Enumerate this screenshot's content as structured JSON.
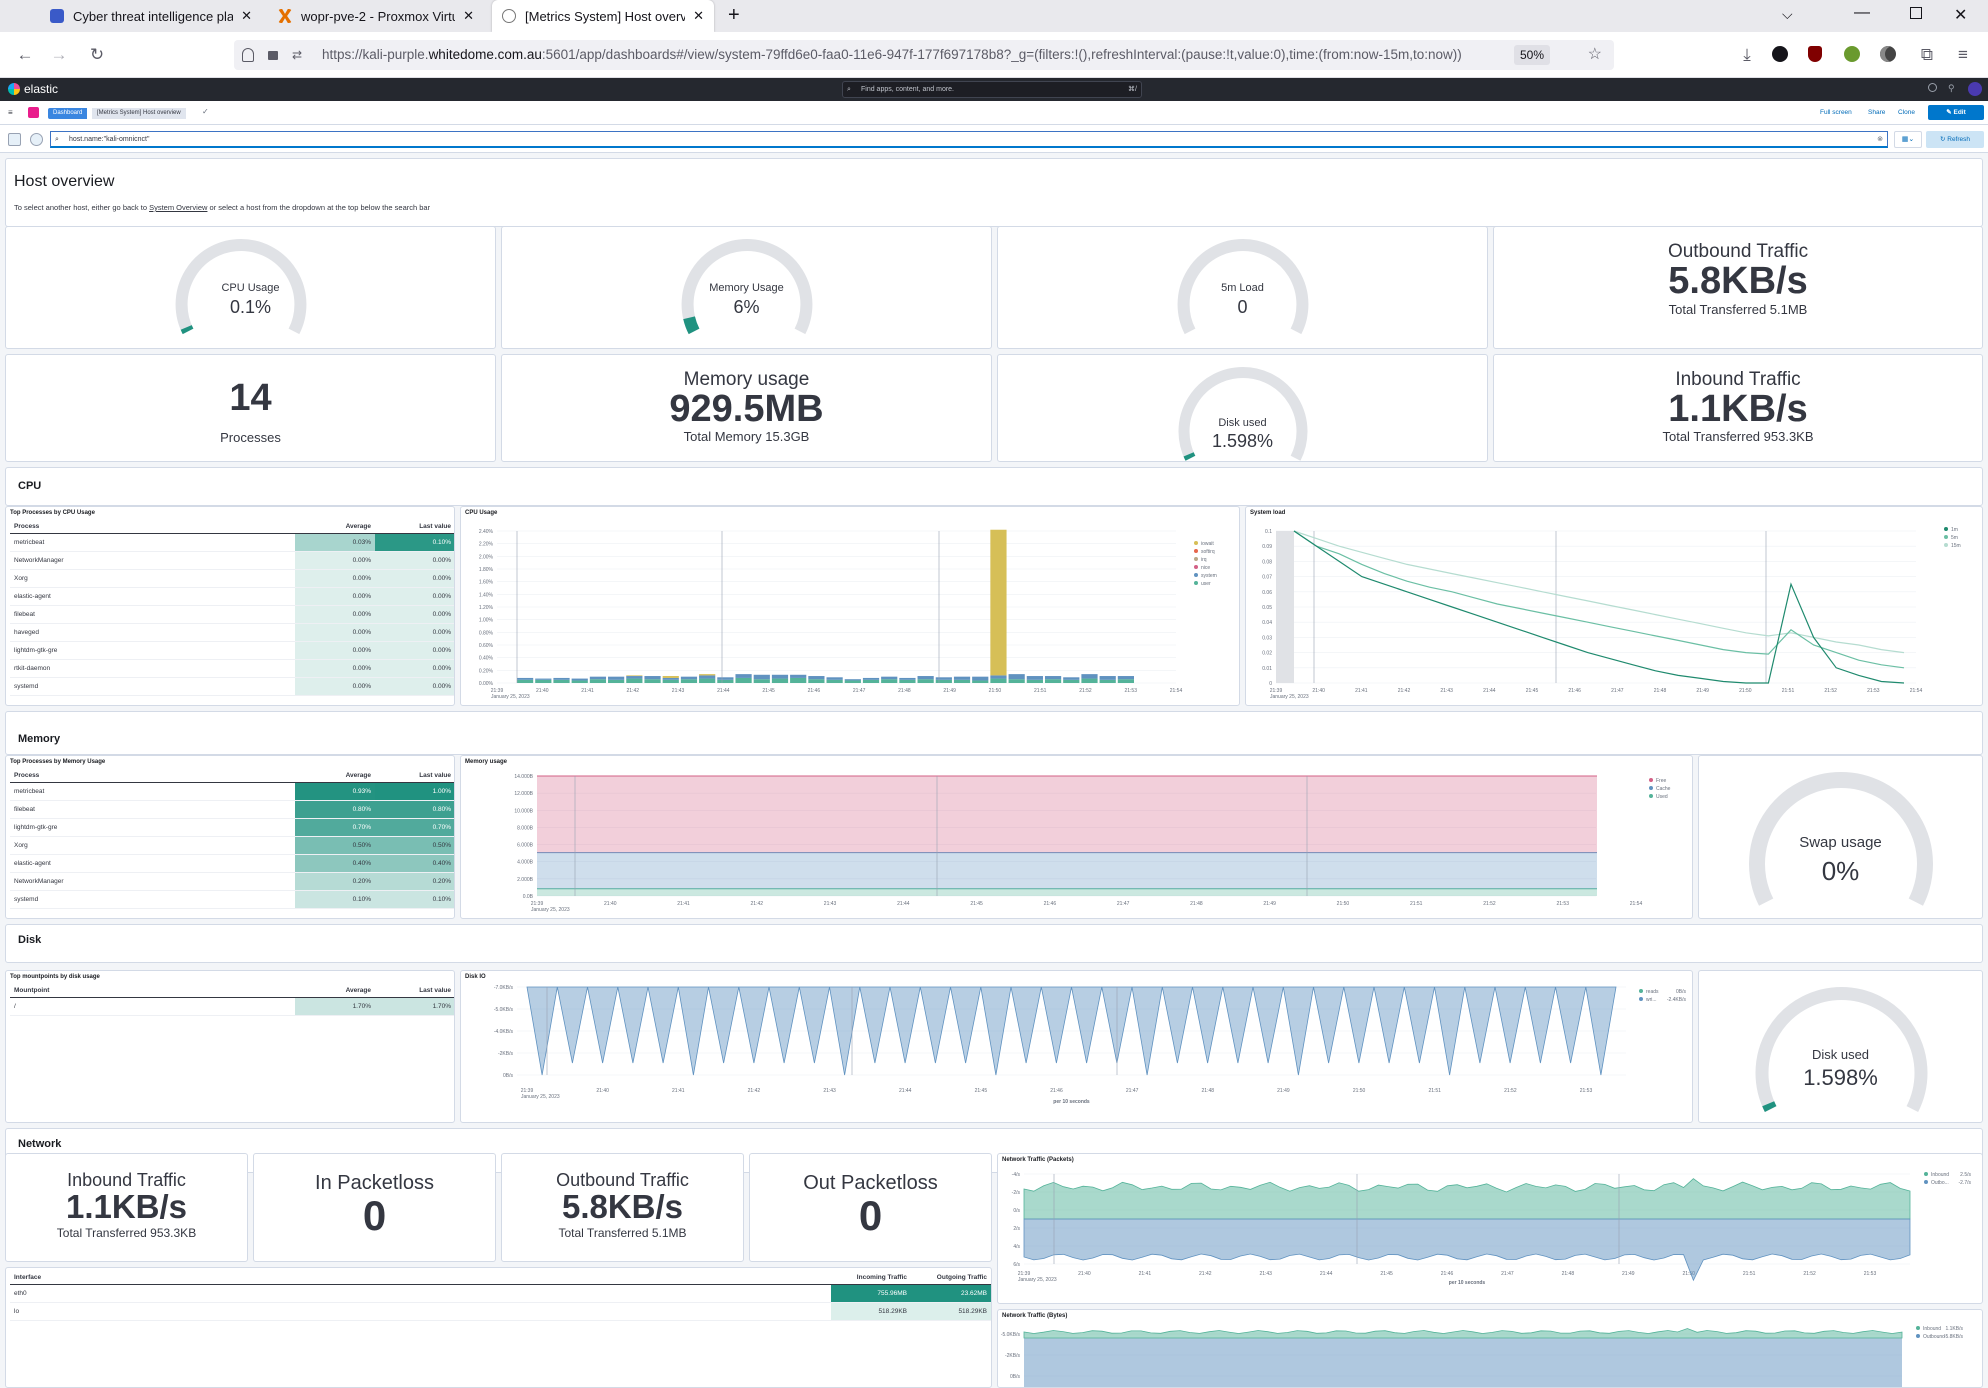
{
  "browser": {
    "tabs": [
      {
        "label": "Cyber threat intelligence platfor",
        "icon": "shield-icon",
        "color": "#3a5ac8"
      },
      {
        "label": "wopr-pve-2 - Proxmox Virtual E",
        "icon": "proxmox-icon",
        "color": "#e57000"
      },
      {
        "label": "[Metrics System] Host overview",
        "icon": "elastic-icon",
        "color": "#777777"
      }
    ],
    "url_prefix": "https://kali-purple.",
    "url_domain": "whitedome.com.au",
    "url_rest": ":5601/app/dashboards#/view/system-79ffd6e0-faa0-11e6-947f-177f697178b8?_g=(filters:!(),refreshInterval:(pause:!t,value:0),time:(from:now-15m,to:now))",
    "zoom": "50%"
  },
  "kibana": {
    "brand": "elastic",
    "search_placeholder": "Find apps, content, and more.",
    "search_shortcut": "⌘/",
    "breadcrumbs": [
      "Dashboard",
      "[Metrics System] Host overview"
    ],
    "actions": [
      "Full screen",
      "Share",
      "Clone",
      "Edit"
    ],
    "query": "host.name:\"kali-omnicnct\"",
    "refresh_label": "Refresh"
  },
  "overview": {
    "title": "Host overview",
    "desc_before": "To select another host, either go back to ",
    "desc_link": "System Overview",
    "desc_after": " or select a host from the dropdown at the top below the search bar"
  },
  "metrics": {
    "cpu": {
      "label": "CPU Usage",
      "value": "0.1%",
      "fraction": 0.001
    },
    "memory": {
      "label": "Memory Usage",
      "value": "6%",
      "fraction": 0.06
    },
    "load": {
      "label": "5m Load",
      "value": "0",
      "fraction": 0
    },
    "outbound": {
      "title": "Outbound Traffic",
      "value": "5.8KB/s",
      "sub": "Total Transferred 5.1MB"
    },
    "processes": {
      "value": "14",
      "label": "Processes"
    },
    "mem_usage": {
      "title": "Memory usage",
      "value": "929.5MB",
      "sub": "Total Memory 15.3GB"
    },
    "disk": {
      "label": "Disk used",
      "value": "1.598%",
      "fraction": 0.016
    },
    "inbound": {
      "title": "Inbound Traffic",
      "value": "1.1KB/s",
      "sub": "Total Transferred 953.3KB"
    },
    "swap": {
      "label": "Swap usage",
      "value": "0%",
      "fraction": 0
    },
    "in_packetloss": {
      "title": "In Packetloss",
      "value": "0"
    },
    "out_packetloss": {
      "title": "Out Packetloss",
      "value": "0"
    }
  },
  "sections": {
    "cpu": "CPU",
    "memory": "Memory",
    "disk": "Disk",
    "network": "Network"
  },
  "cpu_table": {
    "title": "Top Processes by CPU Usage",
    "headers": [
      "Process",
      "Average",
      "Last value"
    ],
    "rows": [
      [
        "metricbeat",
        "0.03%",
        "0.10%"
      ],
      [
        "NetworkManager",
        "0.00%",
        "0.00%"
      ],
      [
        "Xorg",
        "0.00%",
        "0.00%"
      ],
      [
        "elastic-agent",
        "0.00%",
        "0.00%"
      ],
      [
        "filebeat",
        "0.00%",
        "0.00%"
      ],
      [
        "haveged",
        "0.00%",
        "0.00%"
      ],
      [
        "lightdm-gtk-gre",
        "0.00%",
        "0.00%"
      ],
      [
        "rtkit-daemon",
        "0.00%",
        "0.00%"
      ],
      [
        "systemd",
        "0.00%",
        "0.00%"
      ]
    ]
  },
  "mem_table": {
    "title": "Top Processes by Memory Usage",
    "headers": [
      "Process",
      "Average",
      "Last value"
    ],
    "rows": [
      [
        "metricbeat",
        "0.93%",
        "1.00%"
      ],
      [
        "filebeat",
        "0.80%",
        "0.80%"
      ],
      [
        "lightdm-gtk-gre",
        "0.70%",
        "0.70%"
      ],
      [
        "Xorg",
        "0.50%",
        "0.50%"
      ],
      [
        "elastic-agent",
        "0.40%",
        "0.40%"
      ],
      [
        "NetworkManager",
        "0.20%",
        "0.20%"
      ],
      [
        "systemd",
        "0.10%",
        "0.10%"
      ]
    ]
  },
  "disk_table": {
    "title": "Top mountpoints by disk usage",
    "headers": [
      "Mountpoint",
      "Average",
      "Last value"
    ],
    "rows": [
      [
        "/",
        "1.70%",
        "1.70%"
      ]
    ]
  },
  "iface_table": {
    "headers": [
      "Interface",
      "Incoming Traffic",
      "Outgoing Traffic"
    ],
    "rows": [
      [
        "eth0",
        "755.96MB",
        "23.62MB"
      ],
      [
        "lo",
        "518.29KB",
        "518.29KB"
      ]
    ]
  },
  "chart_data": [
    {
      "id": "cpu",
      "type": "bar",
      "title": "CPU Usage",
      "stacked": true,
      "ylabels": [
        "0.00%",
        "0.20%",
        "0.40%",
        "0.60%",
        "0.80%",
        "1.00%",
        "1.20%",
        "1.40%",
        "1.60%",
        "1.80%",
        "2.00%",
        "2.20%",
        "2.40%"
      ],
      "ylim": [
        0,
        2.4
      ],
      "xlabels": [
        "21:39",
        "21:40",
        "21:41",
        "21:42",
        "21:43",
        "21:44",
        "21:45",
        "21:46",
        "21:47",
        "21:48",
        "21:49",
        "21:50",
        "21:51",
        "21:52",
        "21:53",
        "21:54"
      ],
      "date_label": "January 25, 2023",
      "legend": [
        {
          "name": "iowait",
          "color": "#d6bf57"
        },
        {
          "name": "softirq",
          "color": "#e7664c"
        },
        {
          "name": "irq",
          "color": "#b9a888"
        },
        {
          "name": "nice",
          "color": "#d36086"
        },
        {
          "name": "system",
          "color": "#6092c0"
        },
        {
          "name": "user",
          "color": "#54b399"
        }
      ],
      "series": [
        {
          "name": "user",
          "color": "#54b399",
          "values": [
            0.05,
            0.05,
            0.05,
            0.04,
            0.06,
            0.05,
            0.07,
            0.06,
            0.05,
            0.06,
            0.07,
            0.05,
            0.08,
            0.06,
            0.07,
            0.08,
            0.06,
            0.05,
            0.04,
            0.05,
            0.06,
            0.05,
            0.06,
            0.05,
            0.05,
            0.04,
            0.07,
            0.06,
            0.05,
            0.06,
            0.05,
            0.07,
            0.05,
            0.06
          ]
        },
        {
          "name": "system",
          "color": "#6092c0",
          "values": [
            0.03,
            0.02,
            0.03,
            0.03,
            0.04,
            0.05,
            0.04,
            0.05,
            0.03,
            0.04,
            0.05,
            0.04,
            0.06,
            0.07,
            0.06,
            0.05,
            0.05,
            0.04,
            0.02,
            0.03,
            0.04,
            0.03,
            0.05,
            0.04,
            0.05,
            0.06,
            0.05,
            0.08,
            0.06,
            0.05,
            0.04,
            0.07,
            0.06,
            0.05
          ]
        },
        {
          "name": "iowait",
          "color": "#d6bf57",
          "values": [
            0,
            0,
            0,
            0,
            0,
            0,
            0.01,
            0,
            0.03,
            0,
            0.02,
            0,
            0,
            0,
            0,
            0,
            0,
            0,
            0,
            0,
            0,
            0,
            0,
            0,
            0,
            0,
            2.3,
            0,
            0,
            0,
            0,
            0,
            0,
            0
          ]
        }
      ]
    },
    {
      "id": "load",
      "type": "line",
      "title": "System load",
      "ylabels": [
        "0",
        "0.01",
        "0.02",
        "0.03",
        "0.04",
        "0.05",
        "0.06",
        "0.07",
        "0.08",
        "0.09",
        "0.1"
      ],
      "ylim": [
        0,
        0.1
      ],
      "xlabels": [
        "21:39",
        "21:40",
        "21:41",
        "21:42",
        "21:43",
        "21:44",
        "21:45",
        "21:46",
        "21:47",
        "21:48",
        "21:49",
        "21:50",
        "21:51",
        "21:52",
        "21:53",
        "21:54"
      ],
      "date_label": "January 25, 2023",
      "legend": [
        {
          "name": "1m",
          "color": "#1f8a6e"
        },
        {
          "name": "5m",
          "color": "#6bbfa4"
        },
        {
          "name": "15m",
          "color": "#b5dcd0"
        }
      ],
      "series": [
        {
          "name": "1m",
          "color": "#1f8a6e",
          "values": [
            0.1,
            0.09,
            0.08,
            0.07,
            0.065,
            0.06,
            0.055,
            0.05,
            0.045,
            0.04,
            0.035,
            0.03,
            0.025,
            0.02,
            0.016,
            0.012,
            0.008,
            0.005,
            0.003,
            0.001,
            0,
            0,
            0.065,
            0.03,
            0.01,
            0.005,
            0.001,
            0
          ]
        },
        {
          "name": "5m",
          "color": "#6bbfa4",
          "values": [
            0.1,
            0.09,
            0.085,
            0.078,
            0.072,
            0.067,
            0.063,
            0.06,
            0.056,
            0.052,
            0.049,
            0.046,
            0.043,
            0.04,
            0.037,
            0.034,
            0.031,
            0.028,
            0.025,
            0.022,
            0.02,
            0.019,
            0.035,
            0.025,
            0.02,
            0.015,
            0.012,
            0.01
          ]
        },
        {
          "name": "15m",
          "color": "#b5dcd0",
          "values": [
            0.1,
            0.095,
            0.09,
            0.086,
            0.082,
            0.078,
            0.075,
            0.072,
            0.069,
            0.066,
            0.063,
            0.06,
            0.057,
            0.054,
            0.051,
            0.048,
            0.045,
            0.042,
            0.039,
            0.036,
            0.033,
            0.031,
            0.033,
            0.03,
            0.027,
            0.025,
            0.022,
            0.02
          ]
        }
      ]
    },
    {
      "id": "memory",
      "type": "area",
      "title": "Memory usage",
      "stacked": true,
      "ylabels": [
        "0.0B",
        "2.000B",
        "4.000B",
        "6.000B",
        "8.000B",
        "10.000B",
        "12.000B",
        "14.000B"
      ],
      "ylim": [
        0,
        15.3
      ],
      "xlabels": [
        "21:39",
        "21:40",
        "21:41",
        "21:42",
        "21:43",
        "21:44",
        "21:45",
        "21:46",
        "21:47",
        "21:48",
        "21:49",
        "21:50",
        "21:51",
        "21:52",
        "21:53",
        "21:54"
      ],
      "date_label": "January 25, 2023",
      "legend": [
        {
          "name": "Free",
          "color": "#d36086"
        },
        {
          "name": "Cache",
          "color": "#6092c0"
        },
        {
          "name": "Used",
          "color": "#54b399"
        }
      ],
      "series": [
        {
          "name": "Used",
          "color": "#54b399",
          "value": 0.93
        },
        {
          "name": "Cache",
          "color": "#6092c0",
          "value": 4.6
        },
        {
          "name": "Free",
          "color": "#d36086",
          "value": 9.77
        }
      ]
    },
    {
      "id": "diskio",
      "type": "area",
      "title": "Disk IO",
      "ylabels": [
        "0B/s",
        "-2KB/s",
        "-4.0KB/s",
        "-5.0KB/s",
        "-7.0KB/s"
      ],
      "xlabels": [
        "21:39",
        "21:40",
        "21:41",
        "21:42",
        "21:43",
        "21:44",
        "21:45",
        "21:46",
        "21:47",
        "21:48",
        "21:49",
        "21:50",
        "21:51",
        "21:52",
        "21:53"
      ],
      "date_label": "January 25, 2023",
      "xtitle": "per 10 seconds",
      "legend": [
        {
          "name": "reads",
          "value": "0B/s",
          "color": "#54b399"
        },
        {
          "name": "wri...",
          "value": "-2.4KB/s",
          "color": "#6092c0"
        }
      ]
    },
    {
      "id": "netpackets",
      "type": "area",
      "title": "Network Traffic (Packets)",
      "ylabels": [
        "6/s",
        "4/s",
        "2/s",
        "0/s",
        "-2/s",
        "-4/s"
      ],
      "xlabels": [
        "21:39",
        "21:40",
        "21:41",
        "21:42",
        "21:43",
        "21:44",
        "21:45",
        "21:46",
        "21:47",
        "21:48",
        "21:49",
        "21:50",
        "21:51",
        "21:52",
        "21:53"
      ],
      "date_label": "January 25, 2023",
      "xtitle": "per 10 seconds",
      "legend": [
        {
          "name": "Inbound",
          "value": "2.5/s",
          "color": "#54b399"
        },
        {
          "name": "Outbo...",
          "value": "-2.7/s",
          "color": "#6092c0"
        }
      ]
    },
    {
      "id": "netbytes",
      "type": "area",
      "title": "Network Traffic (Bytes)",
      "ylabels": [
        "0B/s",
        "-2KB/s",
        "-5.0KB/s"
      ],
      "legend": [
        {
          "name": "Inbound",
          "value": "1.1KB/s",
          "color": "#54b399"
        },
        {
          "name": "Outbound",
          "value": "-5.8KB/s",
          "color": "#6092c0"
        }
      ]
    }
  ]
}
